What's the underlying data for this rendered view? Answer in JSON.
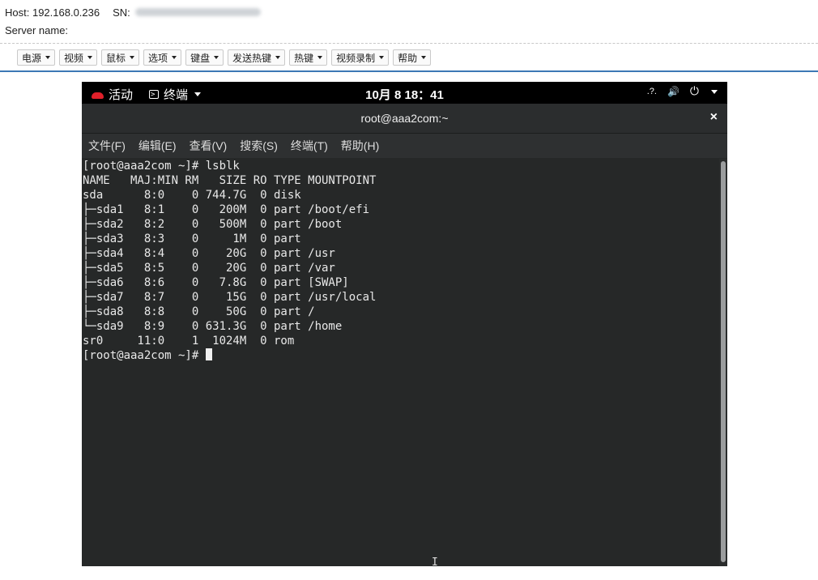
{
  "header": {
    "host_label": "Host:",
    "host_value": "192.168.0.236",
    "sn_label": "SN:",
    "server_name_label": "Server name:"
  },
  "toolbar": {
    "buttons": [
      {
        "label": "电源"
      },
      {
        "label": "视频"
      },
      {
        "label": "鼠标"
      },
      {
        "label": "选项"
      },
      {
        "label": "键盘"
      },
      {
        "label": "发送热键"
      },
      {
        "label": "热键"
      },
      {
        "label": "视频录制"
      },
      {
        "label": "帮助"
      }
    ]
  },
  "gnome_bar": {
    "activities": "活动",
    "app_menu": "终端",
    "clock": "10月 8 18：41",
    "tray": {
      "accessibility": ".?.",
      "volume": "🔊",
      "power": "⏻"
    }
  },
  "terminal": {
    "window_title": "root@aaa2com:~",
    "close_glyph": "×",
    "menu": [
      "文件(F)",
      "编辑(E)",
      "查看(V)",
      "搜索(S)",
      "终端(T)",
      "帮助(H)"
    ],
    "lines": [
      "[root@aaa2com ~]# lsblk",
      "NAME   MAJ:MIN RM   SIZE RO TYPE MOUNTPOINT",
      "sda      8:0    0 744.7G  0 disk",
      "├─sda1   8:1    0   200M  0 part /boot/efi",
      "├─sda2   8:2    0   500M  0 part /boot",
      "├─sda3   8:3    0     1M  0 part",
      "├─sda4   8:4    0    20G  0 part /usr",
      "├─sda5   8:5    0    20G  0 part /var",
      "├─sda6   8:6    0   7.8G  0 part [SWAP]",
      "├─sda7   8:7    0    15G  0 part /usr/local",
      "├─sda8   8:8    0    50G  0 part /",
      "└─sda9   8:9    0 631.3G  0 part /home",
      "sr0     11:0    1  1024M  0 rom"
    ],
    "prompt": "[root@aaa2com ~]# "
  },
  "colors": {
    "accent_line": "#3c78b5",
    "terminal_bg": "#262828",
    "gnome_bar_bg": "#000000"
  }
}
